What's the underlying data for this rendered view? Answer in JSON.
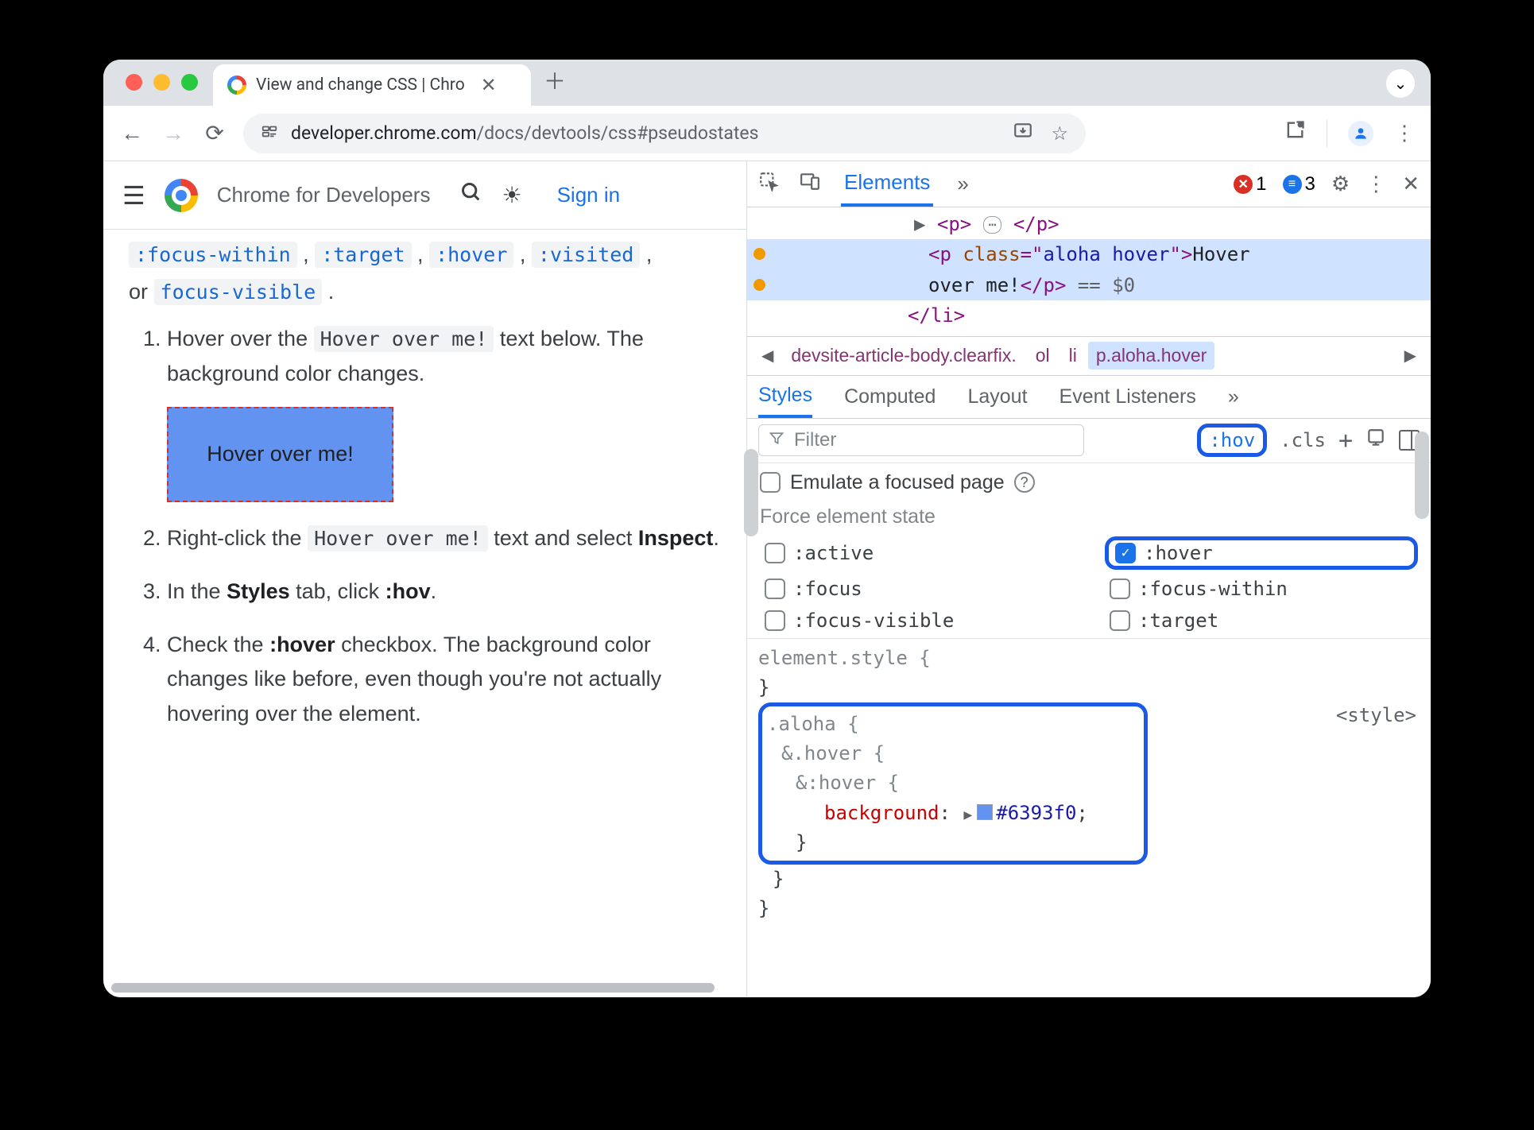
{
  "browser": {
    "tab_title": "View and change CSS  |  Chro",
    "url_host": "developer.chrome.com",
    "url_path": "/docs/devtools/css#pseudostates"
  },
  "page": {
    "header": {
      "brand": "Chrome for Developers",
      "signin": "Sign in"
    },
    "partial_line_codes": [
      ":focus-within",
      ":target",
      ":hover",
      ":visited"
    ],
    "intro_or": "or ",
    "intro_code": "focus-visible",
    "intro_period": " .",
    "steps": {
      "s1a": "Hover over the ",
      "s1code": "Hover over me!",
      "s1b": " text below. The background color changes.",
      "hoverbox": "Hover over me!",
      "s2a": "Right-click the ",
      "s2code": "Hover over me!",
      "s2b": " text and select ",
      "s2strong": "Inspect",
      "s2c": ".",
      "s3a": "In the ",
      "s3strong1": "Styles",
      "s3b": " tab, click ",
      "s3strong2": ":hov",
      "s3c": ".",
      "s4a": "Check the ",
      "s4strong": ":hover",
      "s4b": " checkbox. The background color changes like before, even though you're not actually hovering over the element."
    }
  },
  "devtools": {
    "top": {
      "tab_elements": "Elements",
      "more": "»",
      "errors": "1",
      "msgs": "3"
    },
    "dom": {
      "line1": {
        "open": "<p>",
        "close": "</p>"
      },
      "line2": {
        "open": "<p ",
        "attr": "class",
        "val": "aloha hover",
        "close": ">",
        "text": "Hover "
      },
      "line2b": {
        "text": "over me!",
        "close": "</p>",
        "eq": " == $0"
      },
      "line3": "</li>"
    },
    "crumbs": {
      "c1": "devsite-article-body.clearfix.",
      "c2": "ol",
      "c3": "li",
      "c4": "p.aloha.hover"
    },
    "styles_tabs": {
      "styles": "Styles",
      "computed": "Computed",
      "layout": "Layout",
      "listeners": "Event Listeners",
      "more": "»"
    },
    "filter": {
      "placeholder": "Filter",
      "hov": ":hov",
      "cls": ".cls"
    },
    "states": {
      "emulate": "Emulate a focused page",
      "title": "Force element state",
      "active": ":active",
      "hover": ":hover",
      "focus": ":focus",
      "focuswithin": ":focus-within",
      "focusvisible": ":focus-visible",
      "target": ":target"
    },
    "rules": {
      "elstyle_open": "element.style {",
      "elstyle_close": "}",
      "aloha_open": ".aloha {",
      "hoverclass_open": "&.hover {",
      "hoverpseudo_open": "&:hover {",
      "prop": "background",
      "val": "#6393f0",
      "close": "}",
      "origin": "<style>"
    }
  }
}
